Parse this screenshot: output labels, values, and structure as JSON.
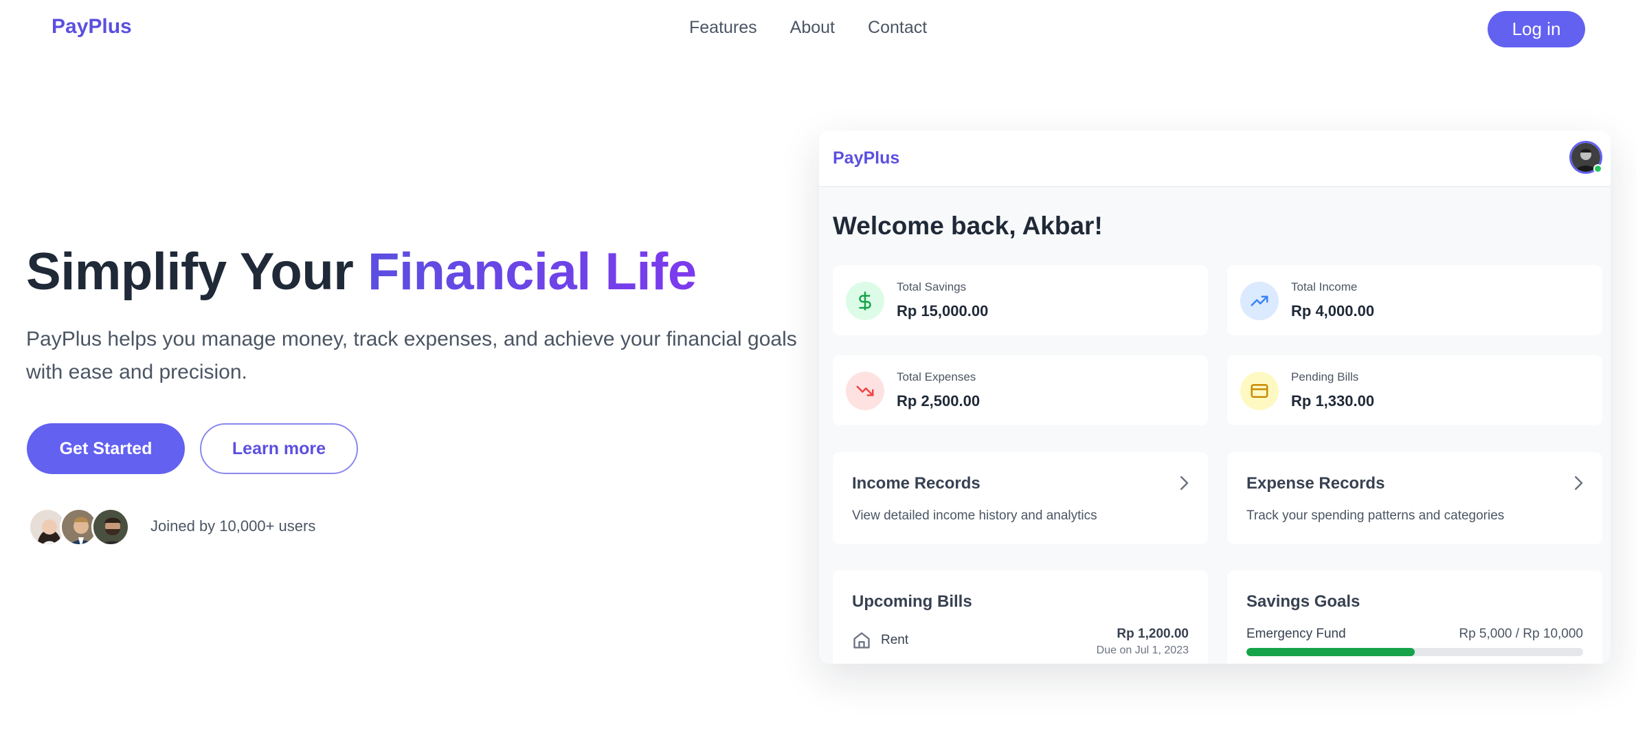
{
  "nav": {
    "brand": "PayPlus",
    "links": [
      "Features",
      "About",
      "Contact"
    ],
    "login_label": "Log in"
  },
  "hero": {
    "title_plain": "Simplify Your ",
    "title_accent": "Financial Life",
    "subtitle": "PayPlus helps you manage money, track expenses, and achieve your financial goals with ease and precision.",
    "primary_cta": "Get Started",
    "secondary_cta": "Learn more",
    "joined_text": "Joined by 10,000+ users"
  },
  "dashboard": {
    "brand": "PayPlus",
    "welcome": "Welcome back, Akbar!",
    "stats": [
      {
        "label": "Total Savings",
        "value": "Rp 15,000.00",
        "icon": "dollar-icon",
        "color": "#16a34a",
        "bg": "#dcfce7"
      },
      {
        "label": "Total Income",
        "value": "Rp 4,000.00",
        "icon": "trending-up-icon",
        "color": "#3b82f6",
        "bg": "#dbeafe"
      },
      {
        "label": "Total Expenses",
        "value": "Rp 2,500.00",
        "icon": "trending-down-icon",
        "color": "#ef4444",
        "bg": "#fee2e2"
      },
      {
        "label": "Pending Bills",
        "value": "Rp 1,330.00",
        "icon": "credit-card-icon",
        "color": "#ca8a04",
        "bg": "#fef9c3"
      }
    ],
    "records": [
      {
        "title": "Income Records",
        "desc": "View detailed income history and analytics"
      },
      {
        "title": "Expense Records",
        "desc": "Track your spending patterns and categories"
      }
    ],
    "bills": {
      "title": "Upcoming Bills",
      "items": [
        {
          "name": "Rent",
          "amount": "Rp 1,200.00",
          "due": "Due on Jul 1, 2023",
          "icon": "home-icon"
        }
      ]
    },
    "goals": {
      "title": "Savings Goals",
      "items": [
        {
          "name": "Emergency Fund",
          "progress_text": "Rp 5,000 / Rp 10,000",
          "progress": 0.5
        }
      ]
    }
  },
  "colors": {
    "accent": "#6361f0",
    "brand": "#5b4fe0",
    "success": "#16a34a"
  }
}
